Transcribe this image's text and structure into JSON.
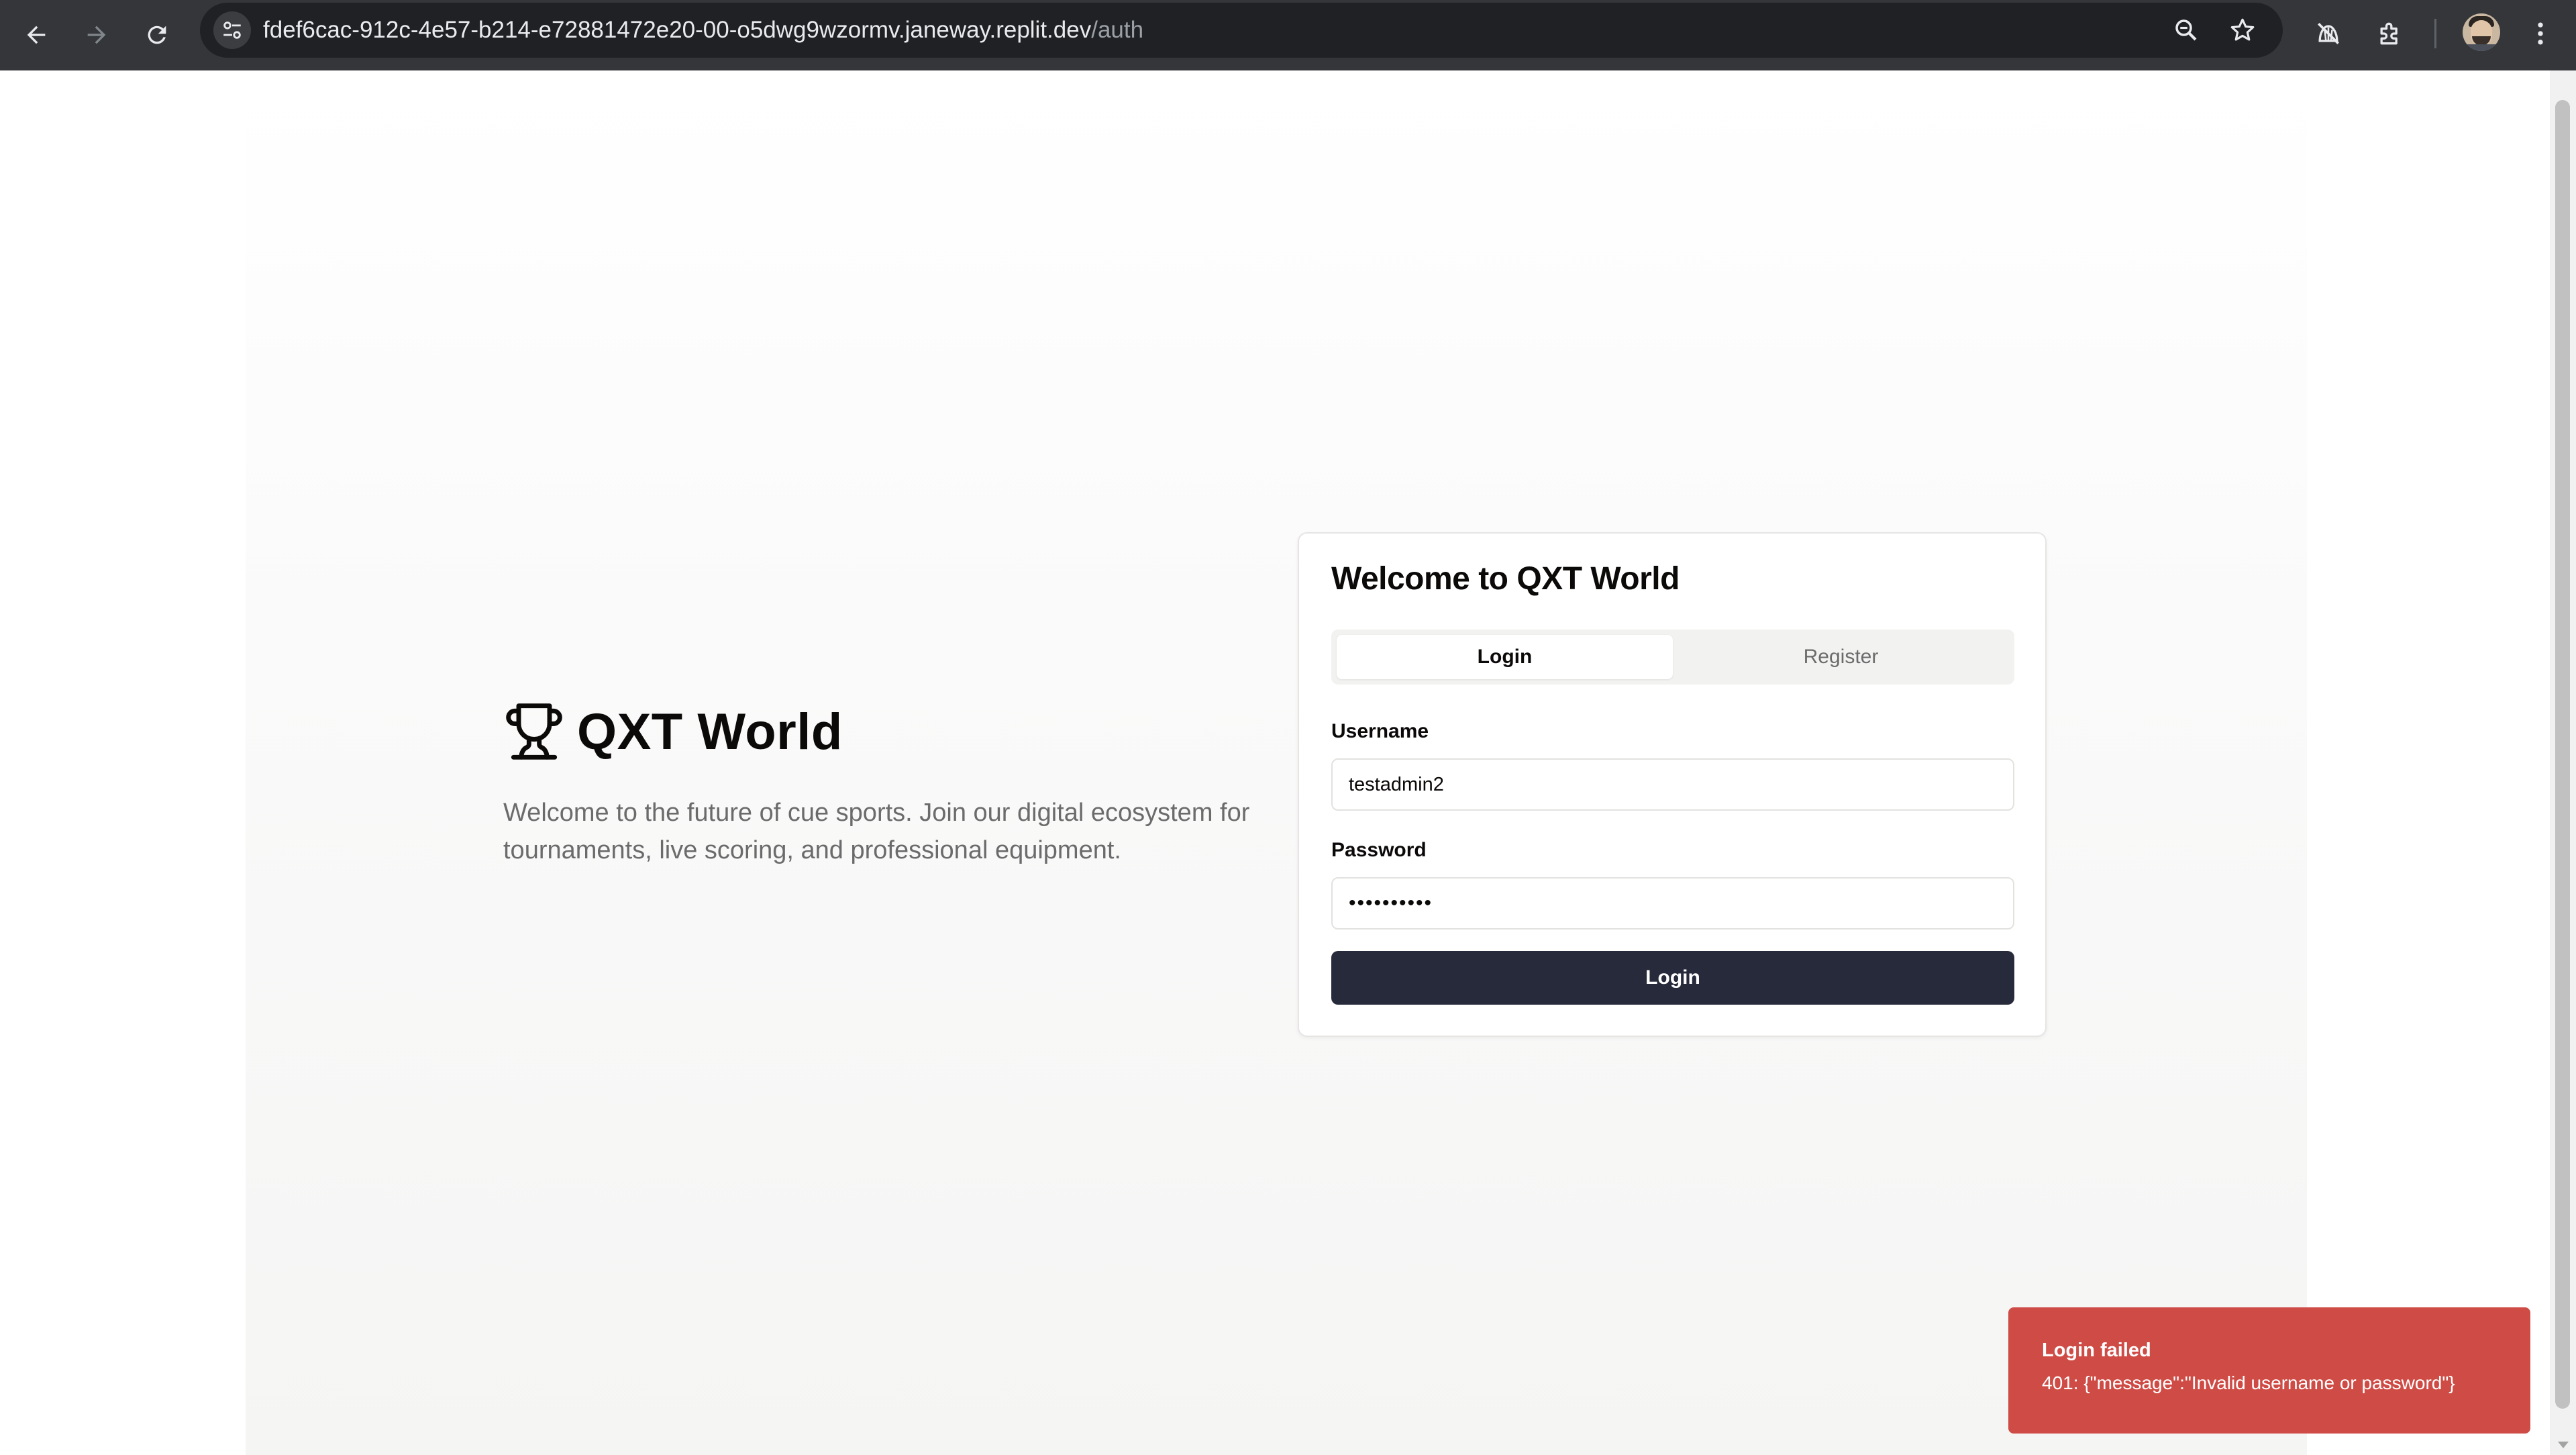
{
  "browser": {
    "url_host": "fdef6cac-912c-4e57-b214-e72881472e20-00-o5dwg9wzormv.janeway.replit.dev",
    "url_path": "/auth",
    "icons": [
      "back-icon",
      "forward-icon",
      "reload-icon",
      "site-info-icon",
      "zoom-icon",
      "bookmark-star-icon",
      "extension-hat-icon",
      "extensions-puzzle-icon",
      "profile-avatar",
      "more-menu-icon"
    ]
  },
  "hero": {
    "title": "QXT World",
    "description": "Welcome to the future of cue sports. Join our digital ecosystem for tournaments, live scoring, and professional equipment.",
    "icon": "trophy-icon"
  },
  "auth": {
    "title": "Welcome to QXT World",
    "tabs": [
      {
        "label": "Login",
        "active": true
      },
      {
        "label": "Register",
        "active": false
      }
    ],
    "username_label": "Username",
    "username_value": "testadmin2",
    "password_label": "Password",
    "password_value": "••••••••••",
    "submit_label": "Login"
  },
  "toast": {
    "title": "Login failed",
    "message": "401: {\"message\":\"Invalid username or password\"}",
    "color": "#cf4c46"
  },
  "colors": {
    "button": "#272a3a",
    "chrome": "#35363a"
  }
}
